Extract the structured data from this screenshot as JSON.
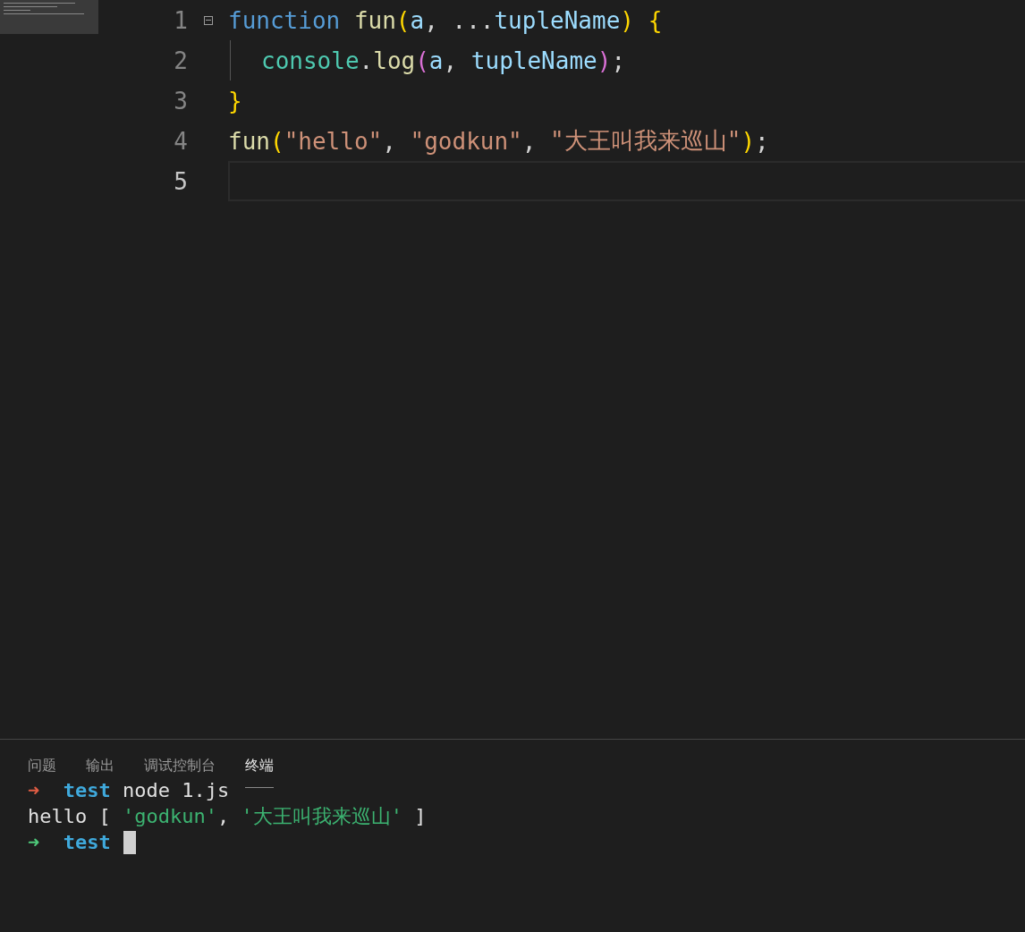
{
  "editor": {
    "lines": [
      {
        "number": "1",
        "foldable": true,
        "indented": false,
        "current": false,
        "tokens": [
          {
            "kind": "keyword",
            "text": "function"
          },
          {
            "kind": "function",
            "text": " fun"
          },
          {
            "kind": "paren",
            "text": "("
          },
          {
            "kind": "variable",
            "text": "a"
          },
          {
            "kind": "plain",
            "text": ", ..."
          },
          {
            "kind": "variable",
            "text": "tupleName"
          },
          {
            "kind": "paren",
            "text": ")"
          },
          {
            "kind": "paren",
            "text": " {"
          }
        ]
      },
      {
        "number": "2",
        "foldable": false,
        "indented": true,
        "current": false,
        "tokens": [
          {
            "kind": "object",
            "text": "console"
          },
          {
            "kind": "plain",
            "text": "."
          },
          {
            "kind": "function",
            "text": "log"
          },
          {
            "kind": "paren2",
            "text": "("
          },
          {
            "kind": "variable",
            "text": "a"
          },
          {
            "kind": "plain",
            "text": ","
          },
          {
            "kind": "variable",
            "text": " tupleName"
          },
          {
            "kind": "paren2",
            "text": ")"
          },
          {
            "kind": "plain",
            "text": ";"
          }
        ]
      },
      {
        "number": "3",
        "foldable": false,
        "indented": false,
        "current": false,
        "tokens": [
          {
            "kind": "paren",
            "text": "}"
          }
        ]
      },
      {
        "number": "4",
        "foldable": false,
        "indented": false,
        "current": false,
        "tokens": [
          {
            "kind": "function",
            "text": "fun"
          },
          {
            "kind": "paren",
            "text": "("
          },
          {
            "kind": "string",
            "text": "\"hello\""
          },
          {
            "kind": "plain",
            "text": ","
          },
          {
            "kind": "string",
            "text": " \"godkun\""
          },
          {
            "kind": "plain",
            "text": ","
          },
          {
            "kind": "string",
            "text": " \"大王叫我来巡山\""
          },
          {
            "kind": "paren",
            "text": ")"
          },
          {
            "kind": "plain",
            "text": ";"
          }
        ]
      },
      {
        "number": "5",
        "foldable": false,
        "indented": false,
        "current": true
      }
    ]
  },
  "panel": {
    "tabs": [
      {
        "label": "问题",
        "selected": false
      },
      {
        "label": "输出",
        "selected": false
      },
      {
        "label": "调试控制台",
        "selected": false
      },
      {
        "label": "终端",
        "selected": true
      }
    ],
    "terminal": {
      "lines": [
        {
          "tokens": [
            {
              "kind": "arrow-error",
              "text": "➜"
            },
            {
              "kind": "dir",
              "text": "  test"
            },
            {
              "kind": "plain",
              "text": " node 1.js"
            }
          ],
          "cursor": false
        },
        {
          "tokens": [
            {
              "kind": "plain",
              "text": "hello ["
            },
            {
              "kind": "string",
              "text": " 'godkun'"
            },
            {
              "kind": "plain",
              "text": ","
            },
            {
              "kind": "string",
              "text": " '大王叫我来巡山'"
            },
            {
              "kind": "plain",
              "text": " ]"
            }
          ],
          "cursor": false
        },
        {
          "tokens": [
            {
              "kind": "arrow-ok",
              "text": "➜"
            },
            {
              "kind": "dir",
              "text": "  test"
            }
          ],
          "cursor": true
        }
      ]
    }
  }
}
